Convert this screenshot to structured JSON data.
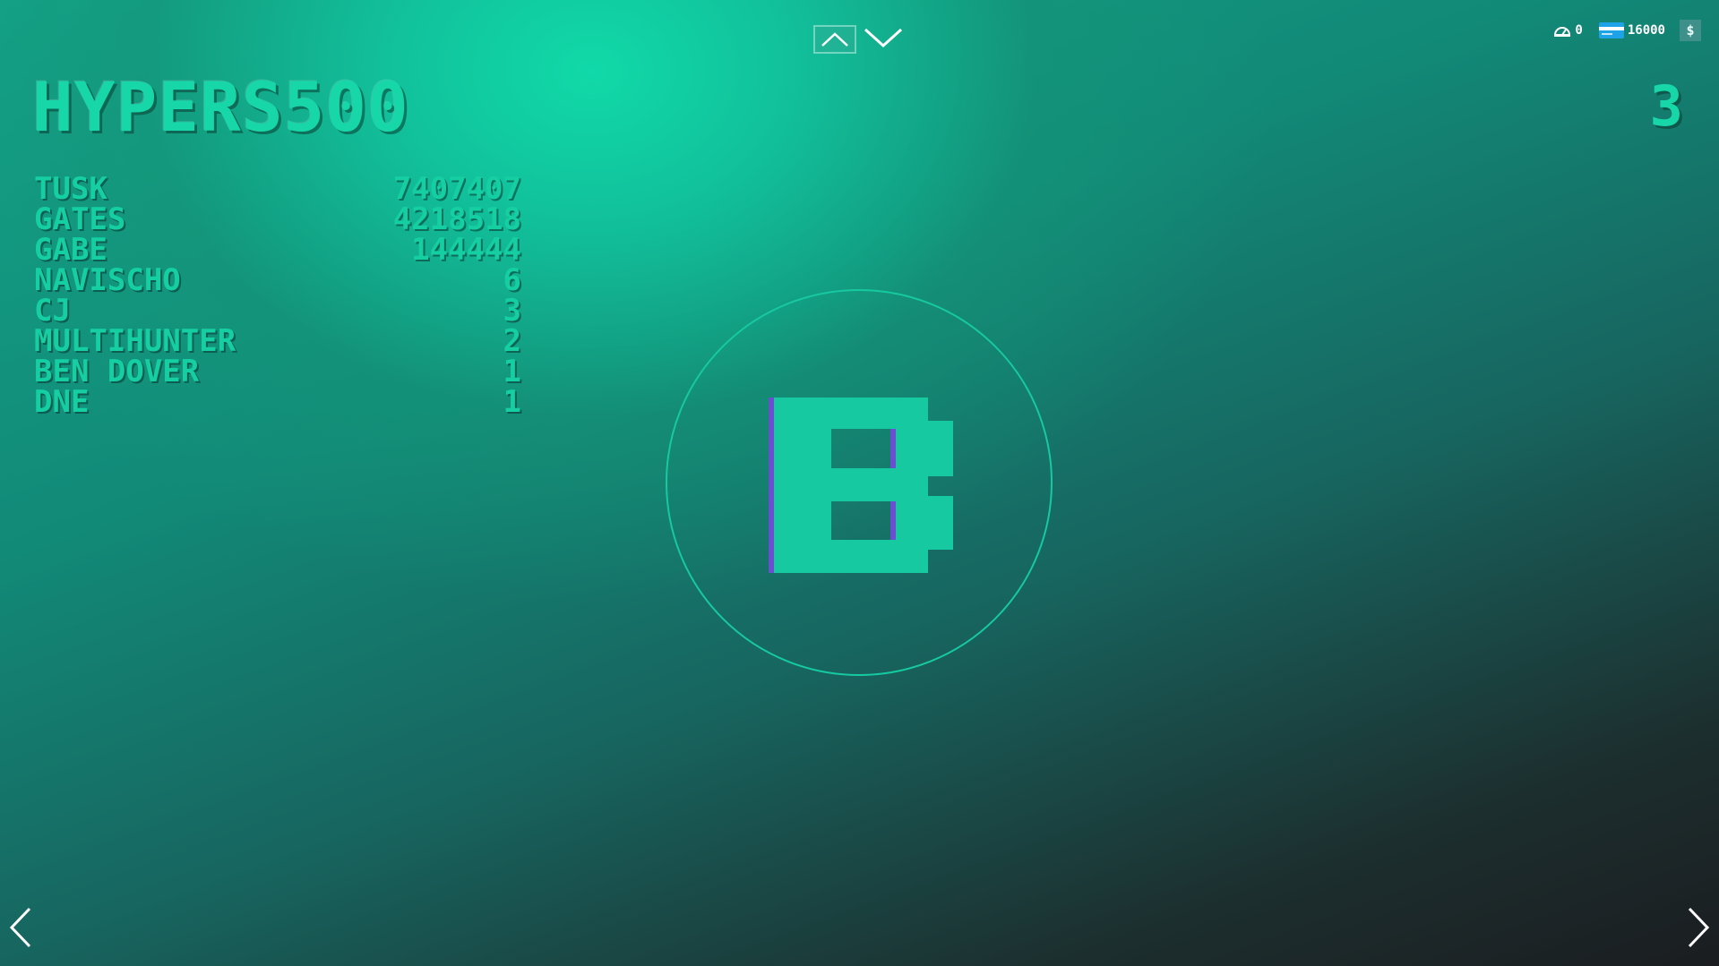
{
  "game": {
    "title": "HYPERS500",
    "counter": "3",
    "center_letter": "B"
  },
  "status": {
    "balance_count": "0",
    "credits": "16000",
    "currency_symbol": "$"
  },
  "leaderboard": [
    {
      "name": "TUSK",
      "score": "7407407"
    },
    {
      "name": "GATES",
      "score": "4218518"
    },
    {
      "name": "GABE",
      "score": "144444"
    },
    {
      "name": "NAVISCHO",
      "score": "6"
    },
    {
      "name": "CJ",
      "score": "3"
    },
    {
      "name": "MULTIHUNTER",
      "score": "2"
    },
    {
      "name": "BEN DOVER",
      "score": "1"
    },
    {
      "name": "DNE",
      "score": "1"
    }
  ],
  "icons": {
    "up": "chevron-up-icon",
    "down": "chevron-down-icon",
    "left": "chevron-left-icon",
    "right": "chevron-right-icon",
    "balance": "odometer-icon",
    "credits": "credit-card-icon"
  },
  "colors": {
    "accent": "#17d7a8",
    "letter_fill": "#16c9a0",
    "letter_edge": "#6a4fd0"
  }
}
